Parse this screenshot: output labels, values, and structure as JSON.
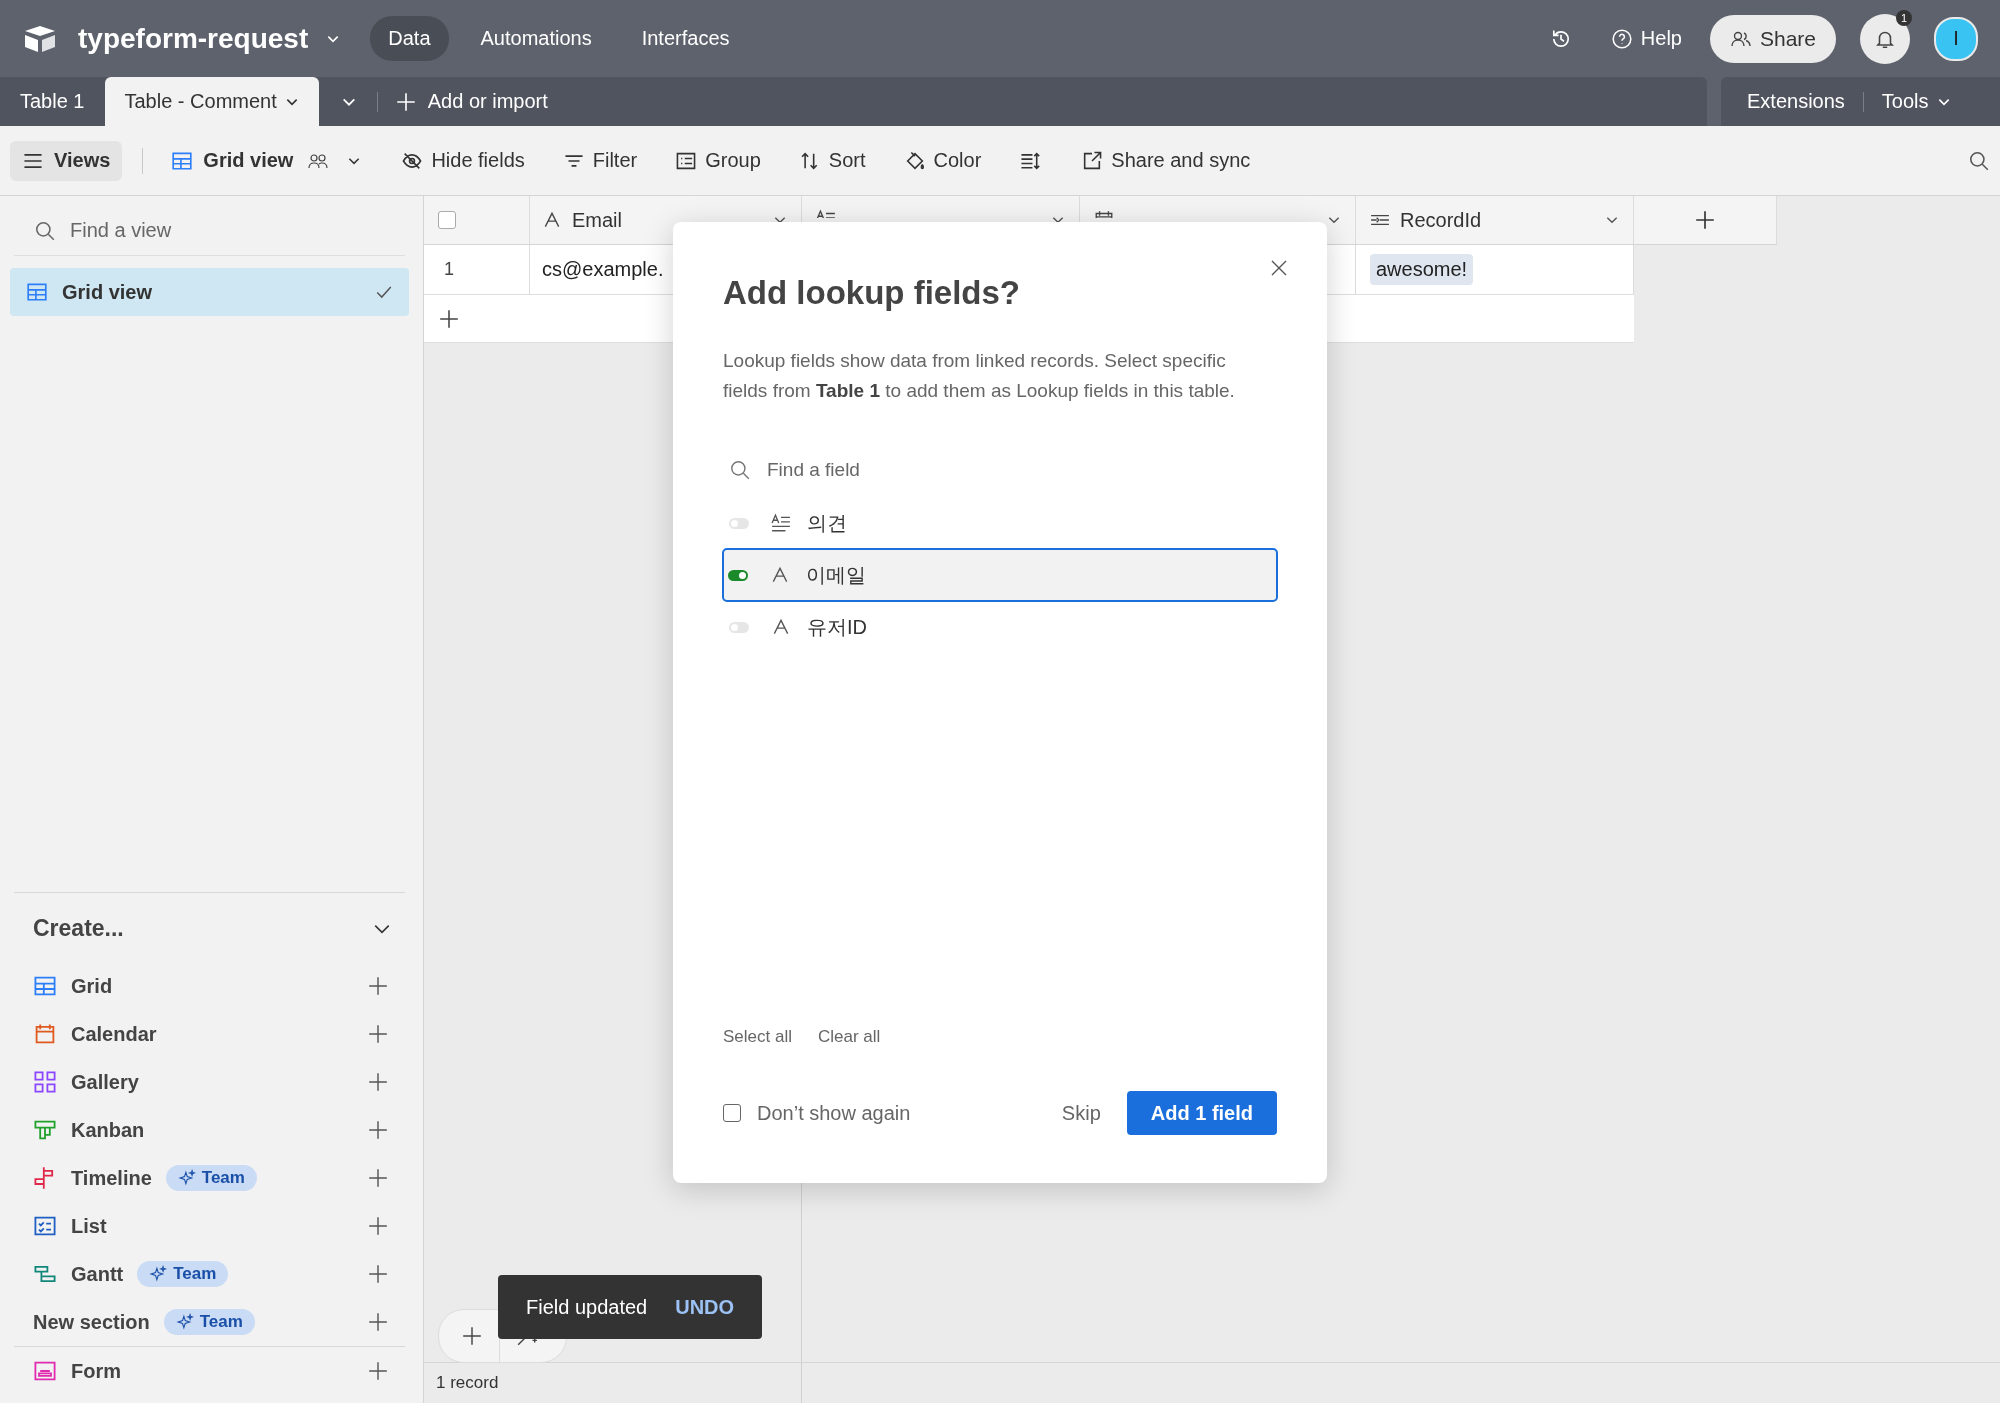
{
  "app": {
    "base_name": "typeform-request",
    "nav": [
      {
        "label": "Data",
        "selected": true
      },
      {
        "label": "Automations",
        "selected": false
      },
      {
        "label": "Interfaces",
        "selected": false
      }
    ],
    "help": "Help",
    "share": "Share",
    "notification_count": "1",
    "avatar": "I"
  },
  "tables": [
    {
      "label": "Table 1",
      "selected": false
    },
    {
      "label": "Table - Comment",
      "selected": true
    }
  ],
  "add_or_import": "Add or import",
  "extensions": "Extensions",
  "tools": "Tools",
  "toolbar": {
    "views": "Views",
    "view_name": "Grid view",
    "items": [
      {
        "kind": "hide",
        "label": "Hide fields"
      },
      {
        "kind": "filter",
        "label": "Filter"
      },
      {
        "kind": "group",
        "label": "Group"
      },
      {
        "kind": "sort",
        "label": "Sort"
      },
      {
        "kind": "color",
        "label": "Color"
      },
      {
        "kind": "row_height"
      },
      {
        "kind": "share",
        "label": "Share and sync"
      }
    ]
  },
  "sidebar": {
    "search_placeholder": "Find a view",
    "views": [
      {
        "label": "Grid view",
        "selected": true
      }
    ],
    "create_title": "Create...",
    "create_items": [
      {
        "kind": "grid",
        "label": "Grid"
      },
      {
        "kind": "calendar",
        "label": "Calendar"
      },
      {
        "kind": "gallery",
        "label": "Gallery"
      },
      {
        "kind": "kanban",
        "label": "Kanban"
      },
      {
        "kind": "timeline",
        "label": "Timeline",
        "badge": "Team"
      },
      {
        "kind": "list",
        "label": "List"
      },
      {
        "kind": "gantt",
        "label": "Gantt",
        "badge": "Team"
      },
      {
        "kind": "section",
        "label": "New section",
        "badge": "Team"
      }
    ],
    "form_items": [
      {
        "kind": "form",
        "label": "Form"
      }
    ]
  },
  "grid": {
    "columns": [
      {
        "kind": "text",
        "name": "Email"
      },
      {
        "kind": "long_text"
      },
      {
        "kind": "date"
      },
      {
        "kind": "formula",
        "name": "RecordId"
      }
    ],
    "select_all_checked": false,
    "rows": [
      {
        "number": "1",
        "email": "cs@example.",
        "record_id": "awesome!"
      }
    ],
    "record_count": "1 record"
  },
  "dialog": {
    "title": "Add lookup fields?",
    "description": "Lookup fields show data from linked records. Select specific fields from **Table 1** to add them as Lookup fields in this table.",
    "search_placeholder": "Find a field",
    "fields": [
      {
        "kind": "long_text",
        "name": "의견",
        "on": false,
        "selected": false
      },
      {
        "kind": "text",
        "name": "이메일",
        "on": true,
        "selected": true
      },
      {
        "kind": "text",
        "name": "유저ID",
        "on": false,
        "selected": false
      }
    ],
    "select_all": "Select all",
    "clear_all": "Clear all",
    "dont_show_again": {
      "label": "Don’t show again",
      "checked": false
    },
    "skip": "Skip",
    "primary": "Add 1 field"
  },
  "toast": {
    "message": "Field updated",
    "action": "UNDO"
  }
}
